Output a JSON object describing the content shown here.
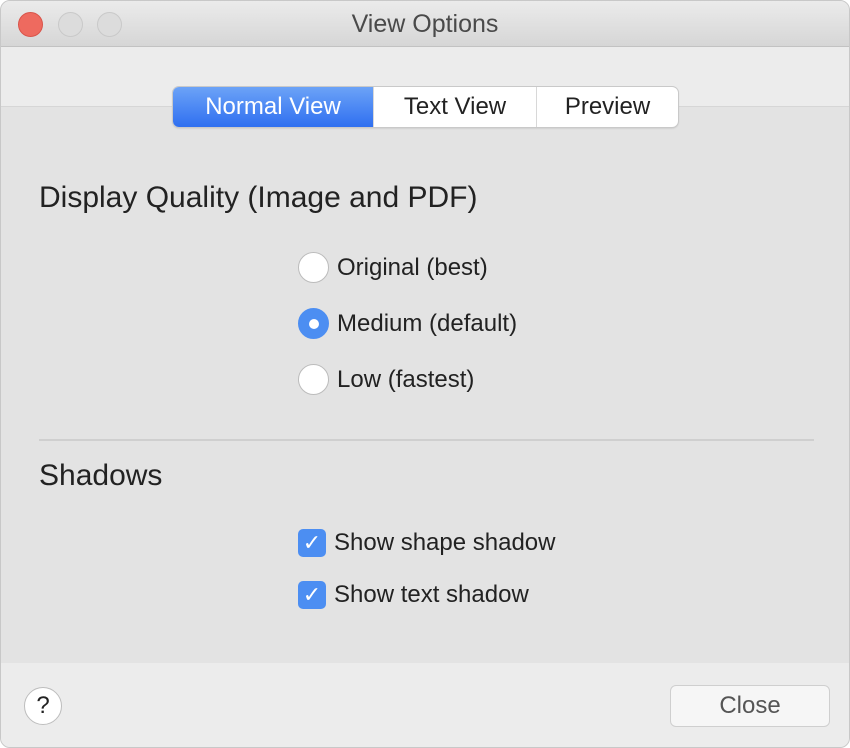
{
  "window": {
    "title": "View Options"
  },
  "tabs": [
    {
      "label": "Normal View",
      "active": true
    },
    {
      "label": "Text View",
      "active": false
    },
    {
      "label": "Preview",
      "active": false
    }
  ],
  "display_quality": {
    "heading": "Display Quality (Image and PDF)",
    "options": [
      {
        "label": "Original (best)",
        "selected": false
      },
      {
        "label": "Medium (default)",
        "selected": true
      },
      {
        "label": "Low (fastest)",
        "selected": false
      }
    ]
  },
  "shadows": {
    "heading": "Shadows",
    "options": [
      {
        "label": "Show shape shadow",
        "checked": true
      },
      {
        "label": "Show text shadow",
        "checked": true
      }
    ]
  },
  "footer": {
    "help_label": "?",
    "close_label": "Close"
  },
  "colors": {
    "accent": "#4c8ef2",
    "close_light": "#ee6a5f"
  }
}
